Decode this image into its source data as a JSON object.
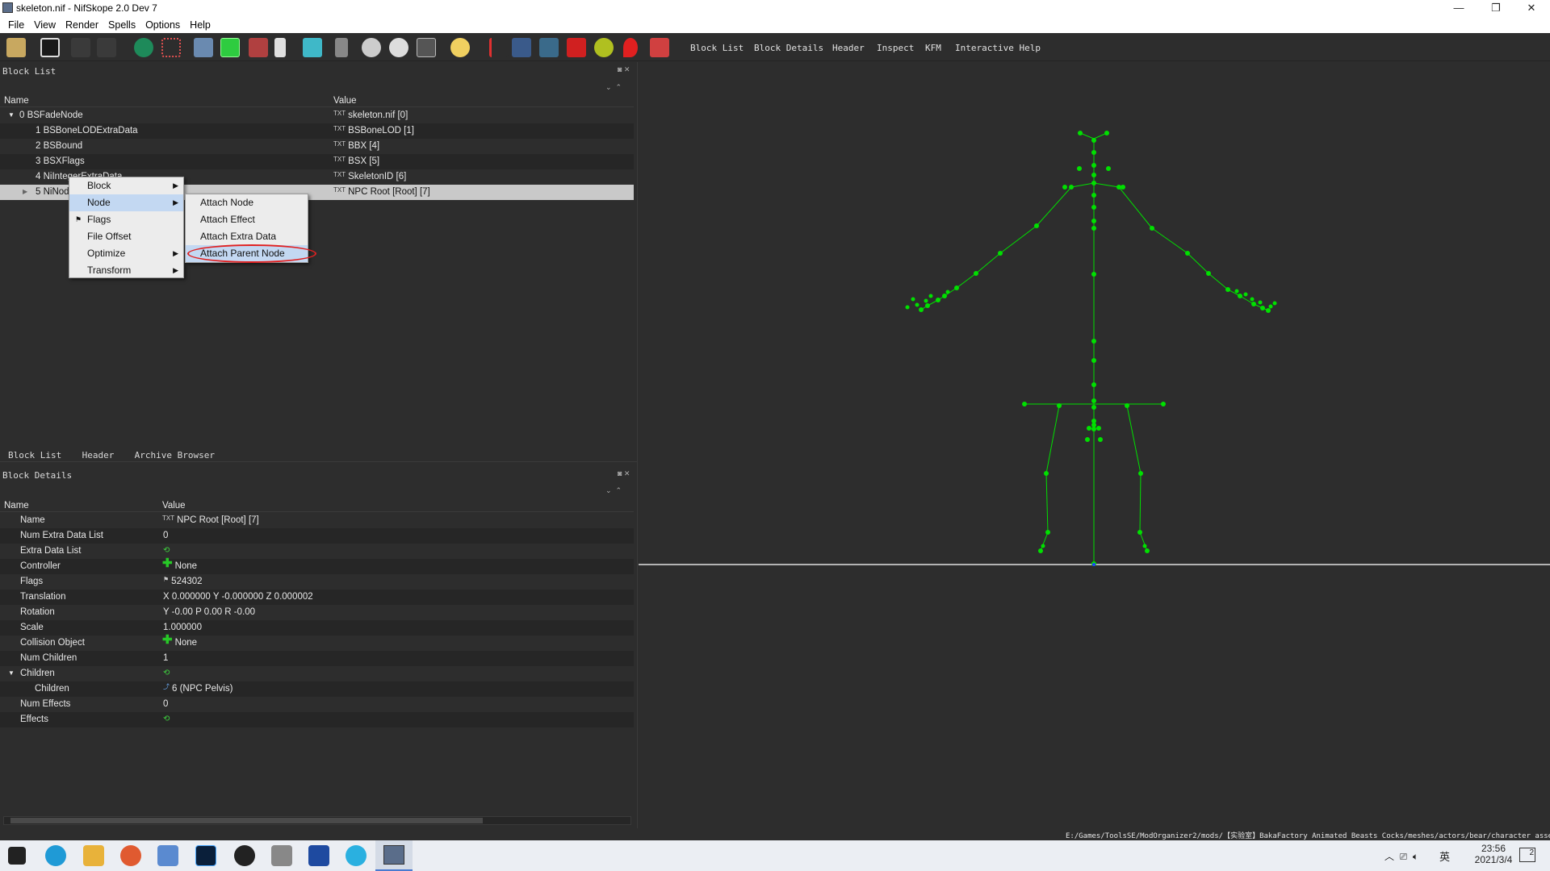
{
  "window": {
    "title": "skeleton.nif - NifSkope 2.0 Dev 7",
    "minimize": "—",
    "maximize": "❐",
    "close": "✕"
  },
  "menu": [
    "File",
    "View",
    "Render",
    "Spells",
    "Options",
    "Help"
  ],
  "toolbar": {
    "tabs": [
      "Block List",
      "Block Details",
      "Header",
      "Inspect",
      "KFM",
      "Interactive Help"
    ]
  },
  "block_list": {
    "title": "Block List",
    "col_name": "Name",
    "col_value": "Value",
    "rows": [
      {
        "name": "0 BSFadeNode",
        "value": "skeleton.nif [0]",
        "icon": "txt-icon"
      },
      {
        "name": "1 BSBoneLODExtraData",
        "value": "BSBoneLOD [1]",
        "icon": "txt-icon"
      },
      {
        "name": "2 BSBound",
        "value": "BBX [4]",
        "icon": "txt-icon"
      },
      {
        "name": "3 BSXFlags",
        "value": "BSX [5]",
        "icon": "txt-icon"
      },
      {
        "name": "4 NiIntegerExtraData",
        "value": "SkeletonID [6]",
        "icon": "txt-icon"
      },
      {
        "name": "5 NiNode",
        "value": "NPC Root [Root] [7]",
        "icon": "txt-icon"
      }
    ],
    "bottom_tabs": [
      "Block List",
      "Header",
      "Archive Browser"
    ]
  },
  "context_menu": {
    "items": [
      "Block",
      "Node",
      "Flags",
      "File Offset",
      "Optimize",
      "Transform"
    ],
    "submenu": [
      "Attach Node",
      "Attach Effect",
      "Attach Extra Data",
      "Attach Parent Node"
    ]
  },
  "block_details": {
    "title": "Block Details",
    "col_name": "Name",
    "col_value": "Value",
    "rows": [
      {
        "name": "Name",
        "value": "NPC Root [Root] [7]",
        "icon": "txt"
      },
      {
        "name": "Num Extra Data List",
        "value": "0",
        "icon": ""
      },
      {
        "name": "Extra Data List",
        "value": "",
        "icon": "cycle"
      },
      {
        "name": "Controller",
        "value": "None",
        "icon": "plus"
      },
      {
        "name": "Flags",
        "value": "524302",
        "icon": "flag"
      },
      {
        "name": "Translation",
        "value": "X 0.000000 Y -0.000000 Z 0.000002",
        "icon": ""
      },
      {
        "name": "Rotation",
        "value": "Y -0.00 P 0.00 R -0.00",
        "icon": ""
      },
      {
        "name": "Scale",
        "value": "1.000000",
        "icon": ""
      },
      {
        "name": "Collision Object",
        "value": "None",
        "icon": "plus"
      },
      {
        "name": "Num Children",
        "value": "1",
        "icon": ""
      },
      {
        "name": "Children",
        "value": "",
        "icon": "cycle"
      },
      {
        "name": "Children",
        "value": "6 (NPC Pelvis)",
        "icon": "link"
      },
      {
        "name": "Num Effects",
        "value": "0",
        "icon": ""
      },
      {
        "name": "Effects",
        "value": "",
        "icon": "cycle"
      }
    ]
  },
  "status_path": "E:/Games/ToolsSE/ModOrganizer2/mods/【实验室】BakaFactory Animated Beasts Cocks/meshes/actors/bear/character assets/skeleton.nif",
  "taskbar": {
    "time": "23:56",
    "date": "2021/3/4",
    "ime": "英",
    "notifications": "2"
  },
  "colors": {
    "bone": "#00e000",
    "ground": "#e0e0e0",
    "highlight_ring": "#e02020"
  }
}
